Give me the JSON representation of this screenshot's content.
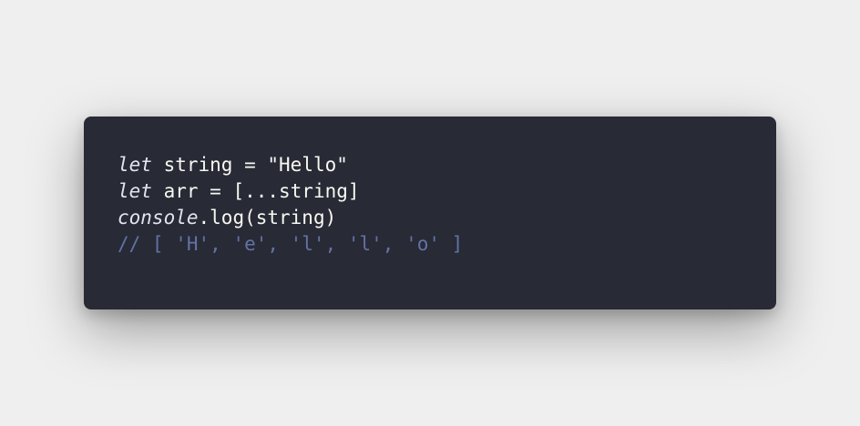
{
  "code": {
    "line1": {
      "keyword": "let",
      "name": " string",
      "op": " = ",
      "value": "\"Hello\""
    },
    "line2": {
      "keyword": "let",
      "name": " arr",
      "op": " = ",
      "value": "[...string]"
    },
    "line3": {
      "object": "console",
      "call": ".log(string)"
    },
    "line4": {
      "comment": "// [ 'H', 'e', 'l', 'l', 'o' ]"
    }
  },
  "colors": {
    "background": "#efefef",
    "editor_background": "#282a36",
    "text": "#f8f8f2",
    "comment": "#6272a4"
  }
}
